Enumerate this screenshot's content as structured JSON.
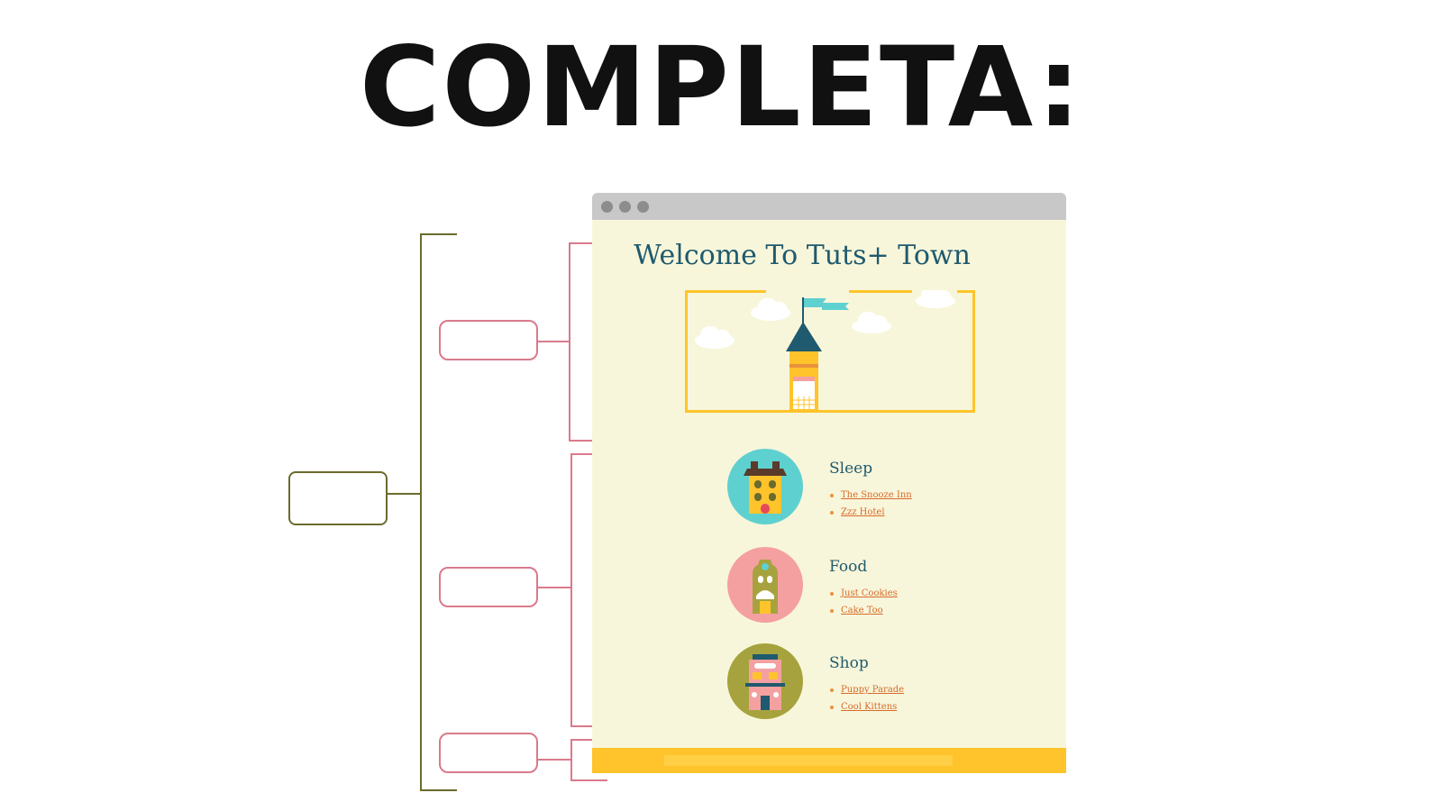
{
  "worksheet": {
    "title": "COMPLETA:"
  },
  "browser": {
    "page_title": "Welcome To Tuts+ Town",
    "sections": [
      {
        "heading": "Sleep",
        "links": [
          "The Snooze Inn",
          "Zzz Hotel"
        ],
        "icon": "yellow-house-icon",
        "circle_color": "#5fd0d0"
      },
      {
        "heading": "Food",
        "links": [
          "Just Cookies",
          "Cake Too"
        ],
        "icon": "cake-shop-icon",
        "circle_color": "#f4a0a0"
      },
      {
        "heading": "Shop",
        "links": [
          "Puppy Parade",
          "Cool Kittens"
        ],
        "icon": "pink-store-icon",
        "circle_color": "#a6a33e"
      }
    ]
  },
  "colors": {
    "main_bracket": "#6b6b2e",
    "sub_bracket": "#d97a8c",
    "page_background": "#f8f6da",
    "accent_yellow": "#ffc42b",
    "heading_blue": "#1f5a6e",
    "link_orange": "#d66b2b"
  }
}
